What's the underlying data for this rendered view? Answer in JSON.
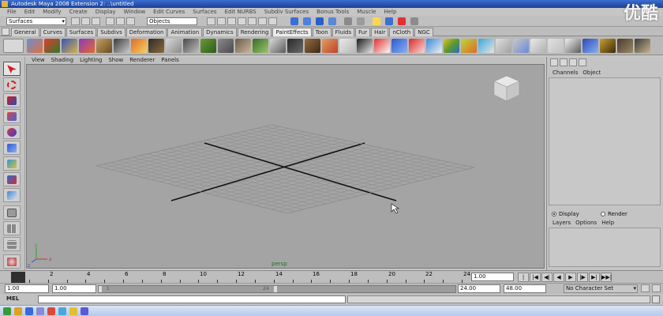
{
  "window": {
    "title": "Autodesk Maya 2008 Extension 2: ..\\untitled"
  },
  "watermark": {
    "text": "优酷"
  },
  "menubar": {
    "items": [
      "File",
      "Edit",
      "Modify",
      "Create",
      "Display",
      "Window",
      "Edit Curves",
      "Surfaces",
      "Edit NURBS",
      "Subdiv Surfaces",
      "Bonus Tools",
      "Muscle",
      "Help"
    ]
  },
  "status_line": {
    "menuset": "Surfaces",
    "selection_mode": "Objects"
  },
  "shelf": {
    "tabs": [
      "General",
      "Curves",
      "Surfaces",
      "Subdivs",
      "Deformation",
      "Animation",
      "Dynamics",
      "Rendering",
      "PaintEffects",
      "Toon",
      "Fluids",
      "Fur",
      "Hair",
      "nCloth",
      "NGC"
    ],
    "active_tab": "PaintEffects"
  },
  "panel_menu": {
    "items": [
      "View",
      "Shading",
      "Lighting",
      "Show",
      "Renderer",
      "Panels"
    ]
  },
  "viewport": {
    "camera": "persp",
    "axis_x": "x",
    "axis_y": "y",
    "axis_z": "z"
  },
  "channel_box": {
    "menu": [
      "Channels",
      "Object"
    ],
    "display_radio": "Display",
    "render_radio": "Render",
    "layers_menu": [
      "Layers",
      "Options",
      "Help"
    ]
  },
  "time_slider": {
    "tick_labels": [
      "2",
      "4",
      "6",
      "8",
      "10",
      "12",
      "14",
      "16",
      "18",
      "20",
      "22",
      "24"
    ],
    "current_frame": "1.00",
    "playback_buttons": [
      "|◀◀",
      "|◀",
      "◀|",
      "◀",
      "▶",
      "|▶",
      "▶|",
      "▶▶|"
    ]
  },
  "range_slider": {
    "start_time": "1.00",
    "playback_start": "1.00",
    "bar_start": "1",
    "bar_end": "24",
    "playback_end": "24.00",
    "end_time": "48.00",
    "character_set": "No Character Set"
  },
  "command_line": {
    "label": "MEL",
    "value": ""
  }
}
